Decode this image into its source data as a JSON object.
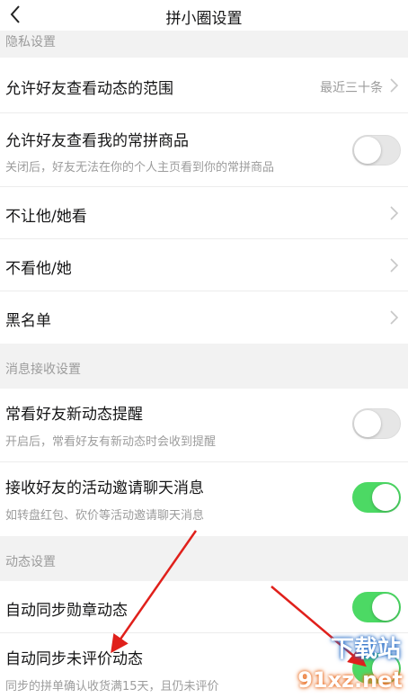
{
  "header": {
    "title": "拼小圈设置"
  },
  "sections": {
    "privacy": "隐私设置",
    "message": "消息接收设置",
    "activity": "动态设置"
  },
  "rows": {
    "allow_view_range": {
      "label": "允许好友查看动态的范围",
      "value": "最近三十条"
    },
    "allow_view_items": {
      "label": "允许好友查看我的常拼商品",
      "desc": "关闭后，好友无法在你的个人主页看到你的常拼商品",
      "on": false
    },
    "block_them": {
      "label": "不让他/她看"
    },
    "hide_them": {
      "label": "不看他/她"
    },
    "blacklist": {
      "label": "黑名单"
    },
    "friend_reminder": {
      "label": "常看好友新动态提醒",
      "desc": "开启后，常看好友有新动态时会收到提醒",
      "on": false
    },
    "invite_chat": {
      "label": "接收好友的活动邀请聊天消息",
      "desc": "如转盘红包、砍价等活动邀请聊天消息",
      "on": true
    },
    "sync_badge": {
      "label": "自动同步勋章动态",
      "on": true
    },
    "sync_unrated": {
      "label": "自动同步未评价动态",
      "desc": "同步的拼单确认收货满15天，且仍未评价"
    }
  },
  "watermark": {
    "top": "下载站",
    "bottom": "91xz.net"
  },
  "colors": {
    "toggle_on": "#4cd964",
    "toggle_off": "#e6e6e6",
    "arrow": "#e0201b"
  }
}
